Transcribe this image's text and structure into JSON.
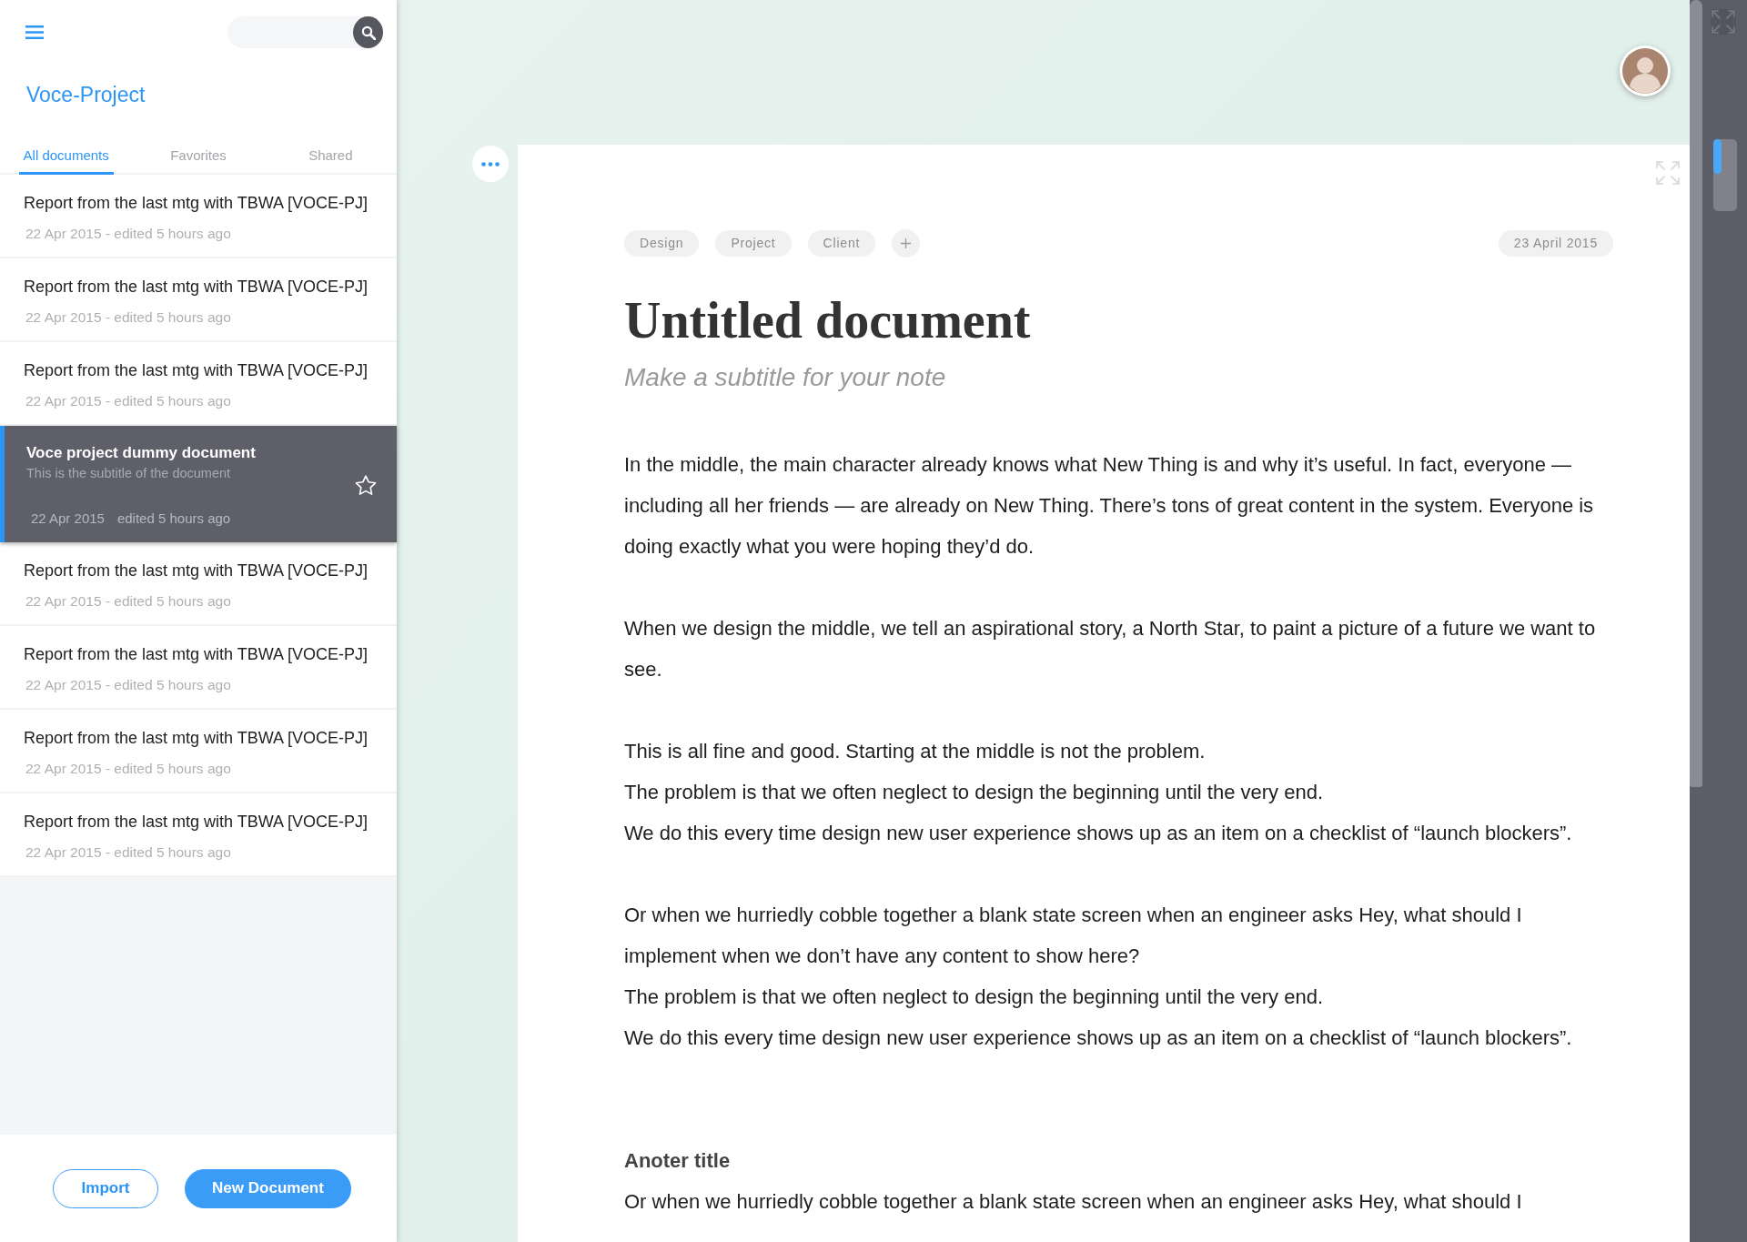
{
  "sidebar": {
    "project_title": "Voce-Project",
    "tabs": [
      {
        "label": "All documents",
        "selected": true
      },
      {
        "label": "Favorites",
        "selected": false
      },
      {
        "label": "Shared",
        "selected": false
      }
    ],
    "documents": [
      {
        "title": "Report from the last mtg with TBWA [VOCE-PJ]",
        "meta": [
          "22 Apr 2015 - edited 5 hours ago"
        ],
        "selected": false,
        "starred": false
      },
      {
        "title": "Report from the last mtg with TBWA [VOCE-PJ]",
        "meta": [
          "22 Apr 2015 - edited 5 hours ago"
        ],
        "selected": false,
        "starred": false
      },
      {
        "title": "Report from the last mtg with TBWA [VOCE-PJ]",
        "meta": [
          "22 Apr 2015 - edited 5 hours ago"
        ],
        "selected": false,
        "starred": false
      },
      {
        "title": "Voce project dummy document",
        "subtitle": "This is the subtitle of the document",
        "meta": [
          "22 Apr 2015",
          "edited 5 hours ago"
        ],
        "selected": true,
        "starred": false
      },
      {
        "title": "Report from the last mtg with TBWA [VOCE-PJ]",
        "meta": [
          "22 Apr 2015 - edited 5 hours ago"
        ],
        "selected": false,
        "starred": false
      },
      {
        "title": "Report from the last mtg with TBWA [VOCE-PJ]",
        "meta": [
          "22 Apr 2015 - edited 5 hours ago"
        ],
        "selected": false,
        "starred": false
      },
      {
        "title": "Report from the last mtg with TBWA [VOCE-PJ]",
        "meta": [
          "22 Apr 2015 - edited 5 hours ago"
        ],
        "selected": false,
        "starred": false
      },
      {
        "title": "Report from the last mtg with TBWA [VOCE-PJ]",
        "meta": [
          "22 Apr 2015 - edited 5 hours ago"
        ],
        "selected": false,
        "starred": false
      }
    ],
    "buttons": [
      {
        "label": "Import",
        "kind": "outline"
      },
      {
        "label": "New Document",
        "kind": "primary"
      }
    ]
  },
  "document": {
    "tags": [
      "Design",
      "Project",
      "Client"
    ],
    "date": "23 April 2015",
    "title": "Untitled document",
    "subtitle": "Make a subtitle for your note",
    "body": [
      {
        "kind": "paragraph",
        "lines": [
          "In the middle, the main character already knows what New Thing is and why it’s useful. In fact, everyone — including all her friends — are already on New Thing. There’s tons of great content in the system. Everyone is doing exactly what you were hoping they’d do."
        ]
      },
      {
        "kind": "paragraph",
        "lines": [
          "When we design the middle, we tell an aspirational story, a North Star, to paint a picture of a future we want to see."
        ]
      },
      {
        "kind": "paragraph",
        "lines": [
          "This is all fine and good. Starting at the middle is not the problem.",
          "The problem is that we often neglect to design the beginning until the very end.",
          "We do this every time design new user experience shows up as an item on a checklist of “launch blockers”."
        ]
      },
      {
        "kind": "paragraph",
        "lines": [
          "Or when we hurriedly cobble together a blank state screen when an engineer asks Hey, what should I implement when we don’t have any content to show here?",
          "The problem is that we often neglect to design the beginning until the very end.",
          "We do this every time design new user experience shows up as an item on a checklist of “launch blockers”."
        ]
      },
      {
        "kind": "heading",
        "text": "Anoter title"
      },
      {
        "kind": "paragraph",
        "lines": [
          "Or when we hurriedly cobble together a blank state screen when an engineer asks Hey, what should I"
        ]
      }
    ]
  }
}
